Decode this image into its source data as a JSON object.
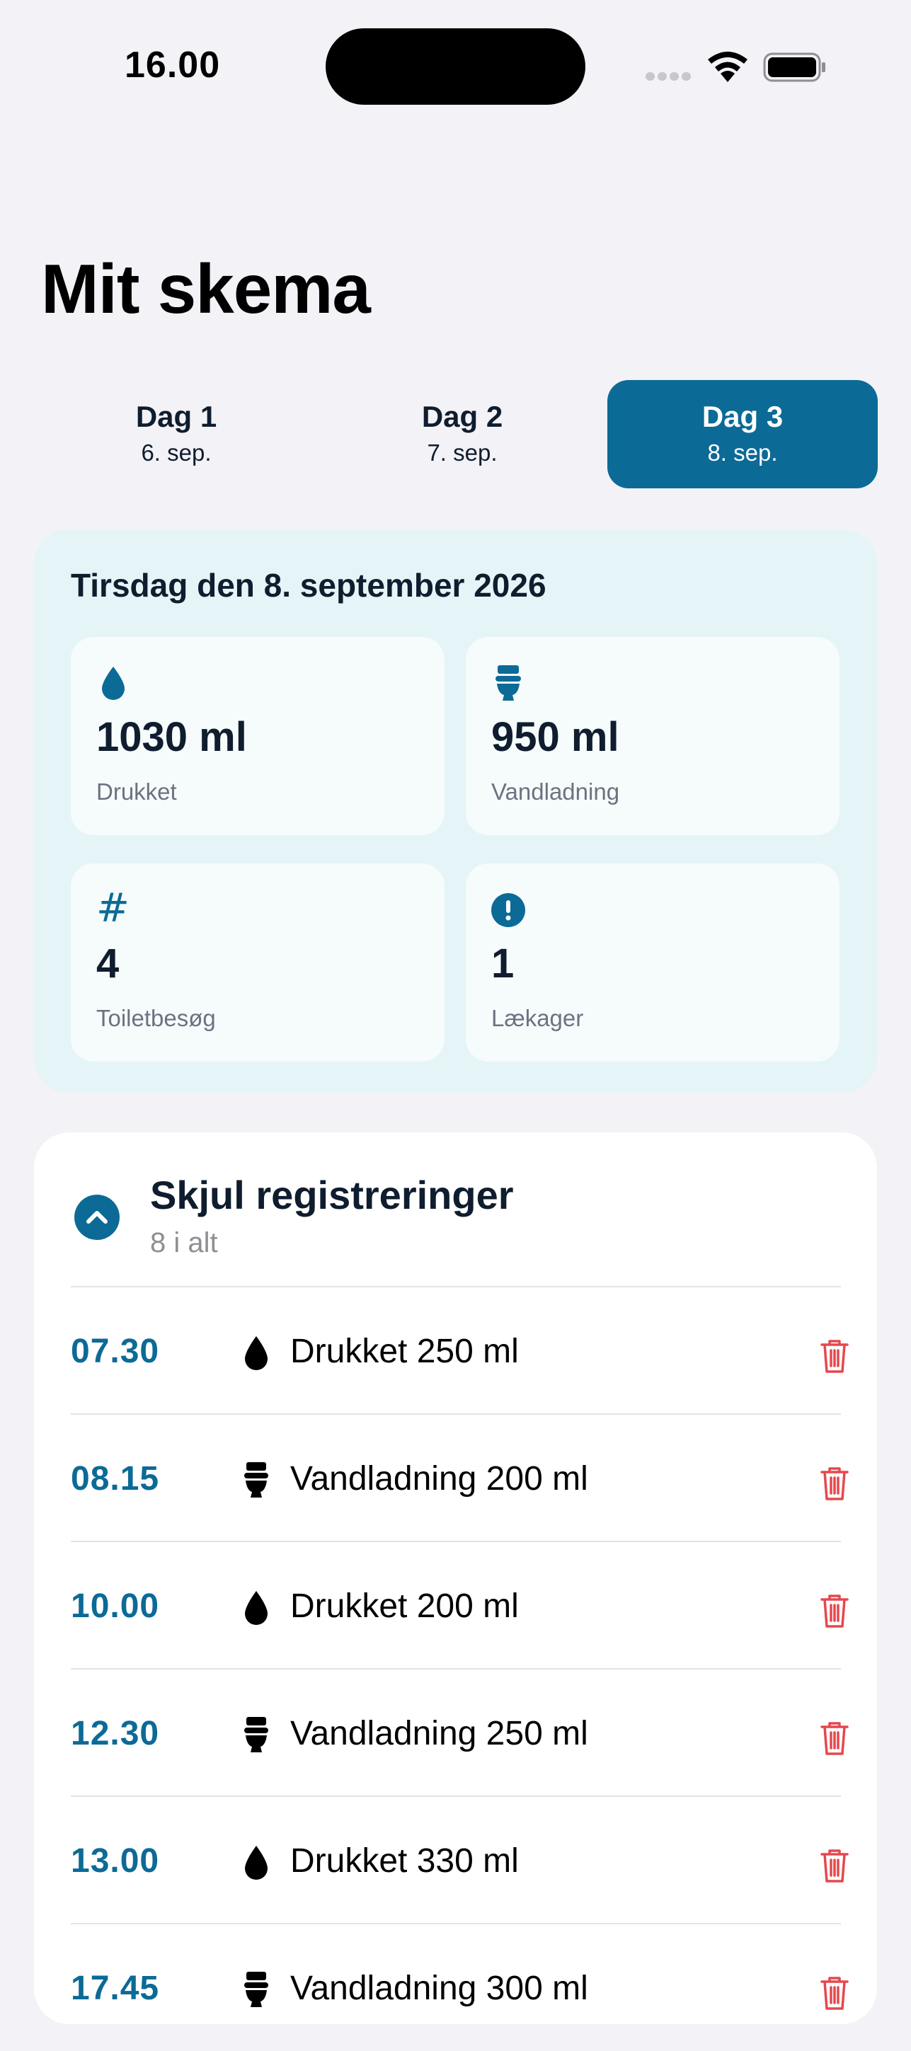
{
  "status_bar": {
    "time": "16.00"
  },
  "title": "Mit skema",
  "day_tabs": [
    {
      "name": "Dag 1",
      "date": "6. sep.",
      "active": false
    },
    {
      "name": "Dag 2",
      "date": "7. sep.",
      "active": false
    },
    {
      "name": "Dag 3",
      "date": "8. sep.",
      "active": true
    }
  ],
  "summary": {
    "date_label": "Tirsdag den 8. september 2026",
    "stats": [
      {
        "icon": "water-drop-icon",
        "value": "1030 ml",
        "label": "Drukket"
      },
      {
        "icon": "toilet-icon",
        "value": "950 ml",
        "label": "Vandladning"
      },
      {
        "icon": "hash-icon",
        "value": "4",
        "label": "Toiletbesøg"
      },
      {
        "icon": "alert-icon",
        "value": "1",
        "label": "Lækager"
      }
    ],
    "hash_symbol": "#"
  },
  "registrations": {
    "toggle_label": "Skjul registreringer",
    "count_label": "8 i alt",
    "entries": [
      {
        "time": "07.30",
        "type": "water-drop-icon",
        "text": "Drukket 250 ml"
      },
      {
        "time": "08.15",
        "type": "toilet-icon",
        "text": "Vandladning 200 ml"
      },
      {
        "time": "10.00",
        "type": "water-drop-icon",
        "text": "Drukket 200 ml"
      },
      {
        "time": "12.30",
        "type": "toilet-icon",
        "text": "Vandladning 250 ml"
      },
      {
        "time": "13.00",
        "type": "water-drop-icon",
        "text": "Drukket 330 ml"
      },
      {
        "time": "17.45",
        "type": "toilet-icon",
        "text": "Vandladning 300 ml"
      }
    ]
  },
  "colors": {
    "accent": "#0c6a96",
    "delete": "#e5484d",
    "summary_bg": "#e5f4f7"
  }
}
